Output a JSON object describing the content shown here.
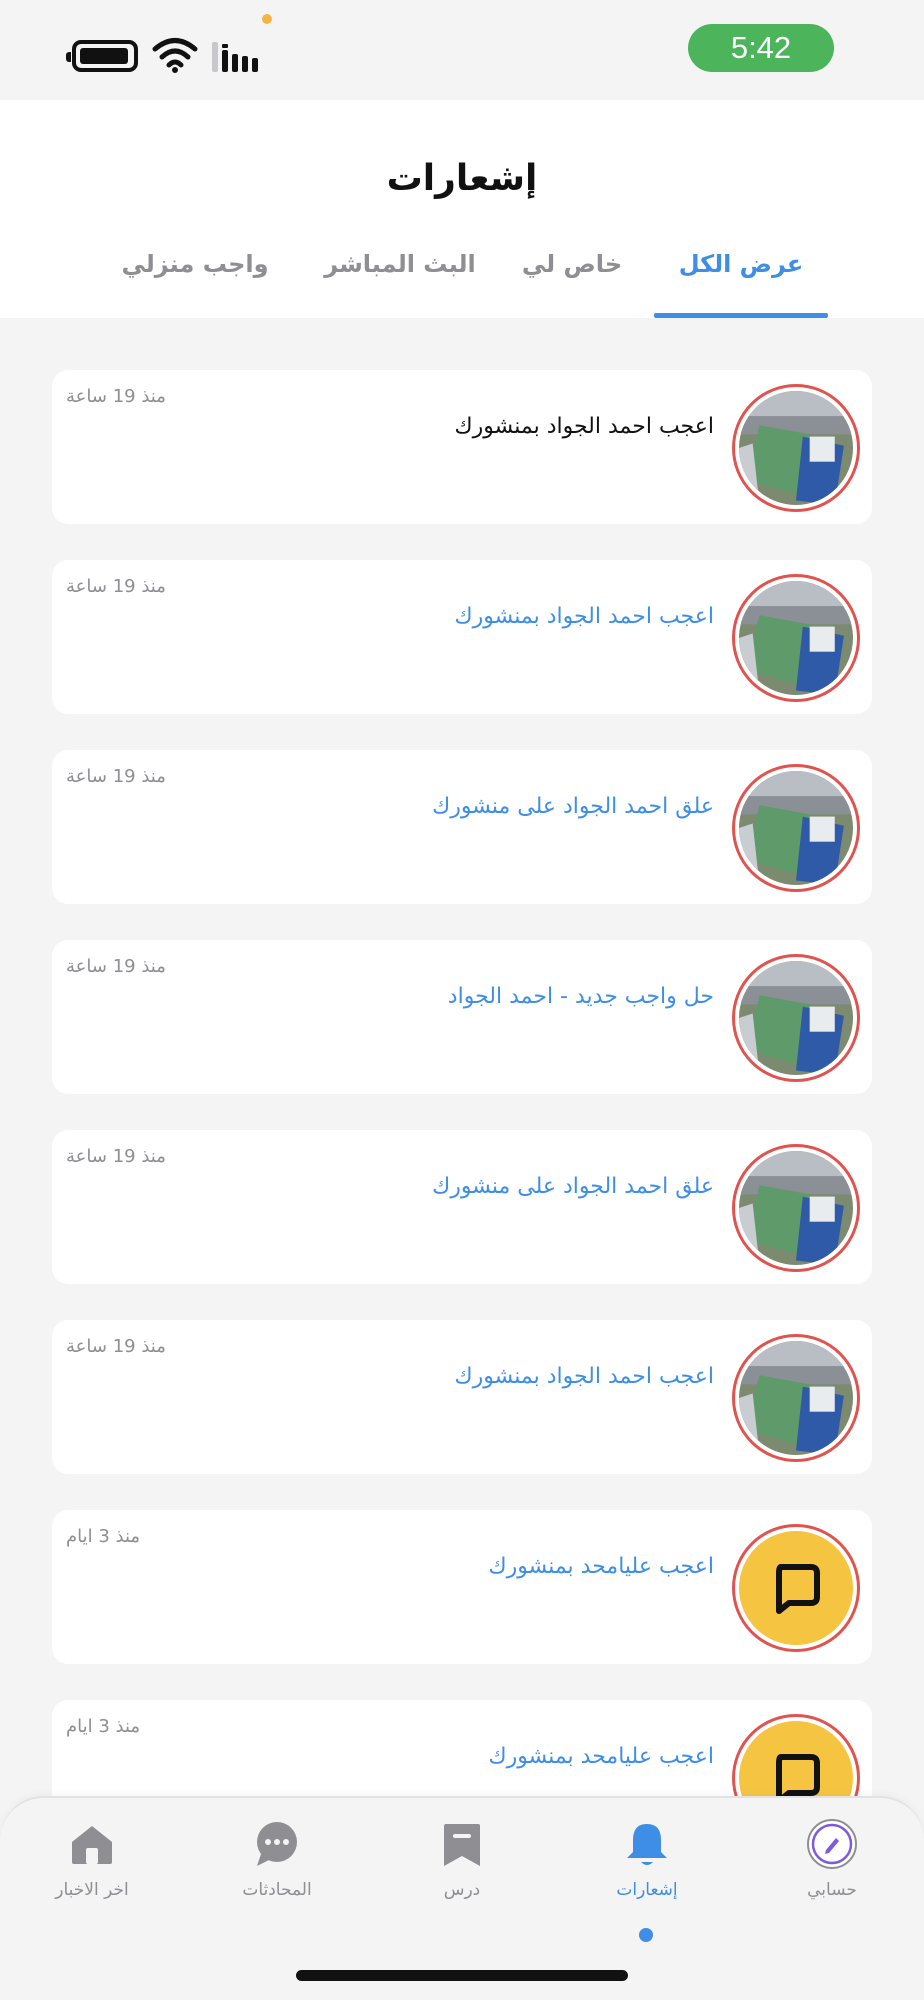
{
  "status_bar": {
    "time": "5:42",
    "time_pill_color": "#4cb45a"
  },
  "header": {
    "title": "إشعارات"
  },
  "tabs": [
    {
      "label": "عرض الكل",
      "active": true
    },
    {
      "label": "خاص لي",
      "active": false
    },
    {
      "label": "البث المباشر",
      "active": false
    },
    {
      "label": "واجب منزلي",
      "active": false
    }
  ],
  "notifications": [
    {
      "text": "اعجب احمد الجواد بمنشورك",
      "time": "منذ 19 ساعة",
      "avatar": "port-photo",
      "read": true
    },
    {
      "text": "اعجب احمد الجواد بمنشورك",
      "time": "منذ 19 ساعة",
      "avatar": "port-photo",
      "read": false
    },
    {
      "text": "علق احمد الجواد على منشورك",
      "time": "منذ 19 ساعة",
      "avatar": "port-photo",
      "read": false
    },
    {
      "text": "حل واجب جديد - احمد الجواد",
      "time": "منذ 19 ساعة",
      "avatar": "port-photo",
      "read": false
    },
    {
      "text": "علق احمد الجواد على منشورك",
      "time": "منذ 19 ساعة",
      "avatar": "port-photo",
      "read": false
    },
    {
      "text": "اعجب احمد الجواد بمنشورك",
      "time": "منذ 19 ساعة",
      "avatar": "port-photo",
      "read": false
    },
    {
      "text": "اعجب عليامحد بمنشورك",
      "time": "منذ 3 ايام",
      "avatar": "chat-logo",
      "read": false
    },
    {
      "text": "اعجب عليامحد بمنشورك",
      "time": "منذ 3 ايام",
      "avatar": "chat-logo",
      "read": false
    }
  ],
  "bottom_nav": [
    {
      "label": "اخر الاخبار",
      "icon": "home-icon"
    },
    {
      "label": "المحادثات",
      "icon": "chat-icon"
    },
    {
      "label": "درس",
      "icon": "bookmark-icon"
    },
    {
      "label": "إشعارات",
      "icon": "bell-icon",
      "active": true
    },
    {
      "label": "حسابي",
      "icon": "profile-icon"
    }
  ],
  "colors": {
    "accent": "#3f8ee6",
    "avatar_border": "#e0534f",
    "logo_yellow": "#f5c542"
  }
}
